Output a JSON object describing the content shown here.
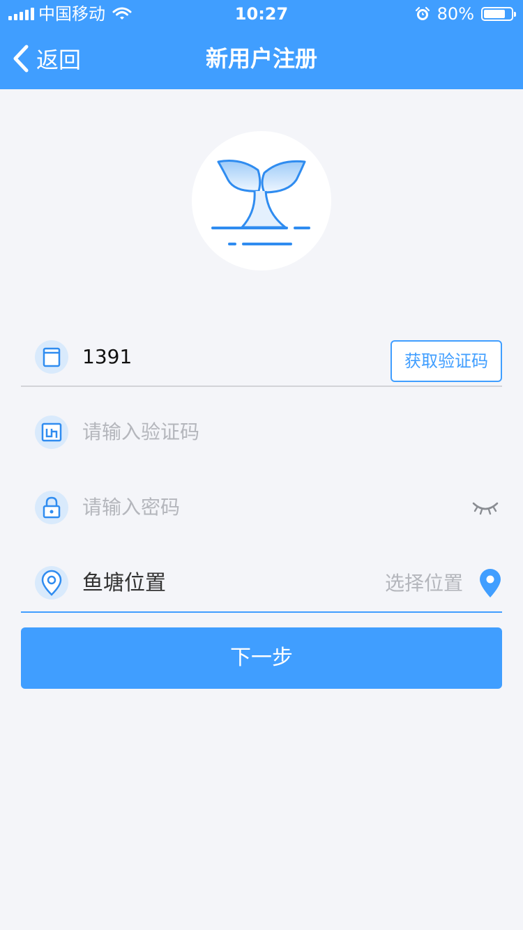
{
  "status_bar": {
    "carrier": "中国移动",
    "time": "10:27",
    "battery": "80%",
    "battery_level": 0.8
  },
  "nav": {
    "back_label": "返回",
    "title": "新用户注册"
  },
  "form": {
    "phone_value": "1391",
    "get_code_label": "获取验证码",
    "code_placeholder": "请输入验证码",
    "password_placeholder": "请输入密码",
    "location_label": "鱼塘位置",
    "location_select": "选择位置",
    "next_label": "下一步"
  },
  "colors": {
    "accent": "#409eff",
    "background": "#f4f5f9",
    "placeholder": "#b4b6bc",
    "icon_bg": "#d9eafc"
  },
  "icons": {
    "back": "chevron-left-icon",
    "phone": "phone-icon",
    "code": "verification-code-icon",
    "password": "lock-icon",
    "location": "location-icon",
    "eye": "eye-closed-icon",
    "pin": "map-pin-icon",
    "logo": "sprout-logo"
  }
}
